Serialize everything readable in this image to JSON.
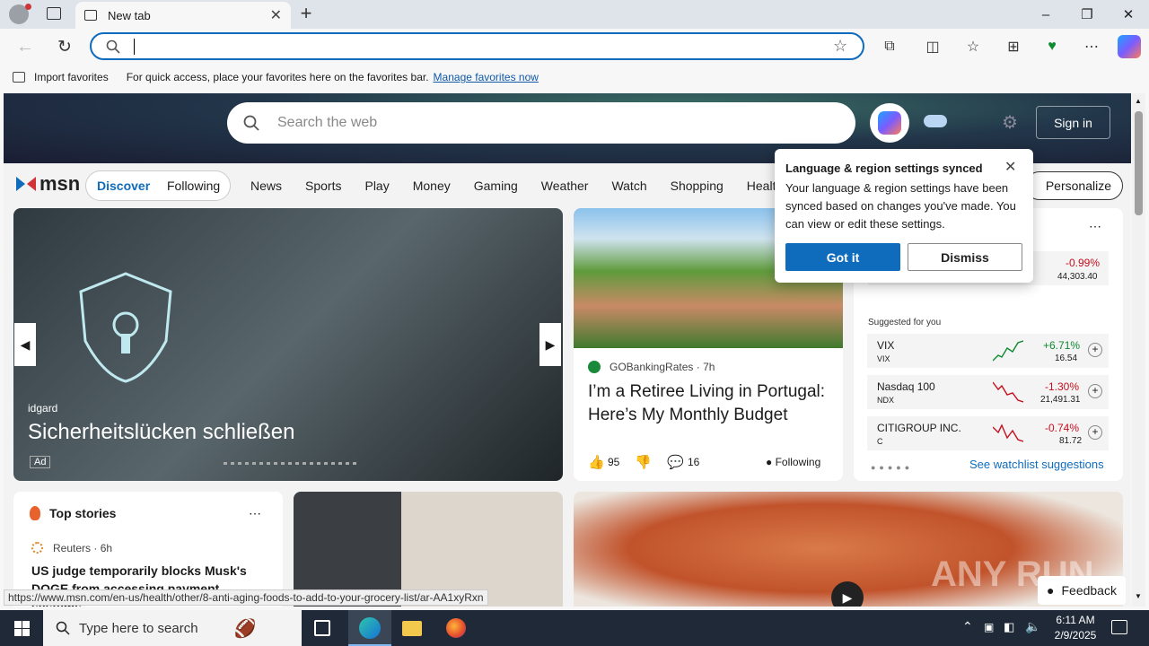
{
  "browser": {
    "tab_title": "New tab",
    "favbar": {
      "import": "Import favorites",
      "hint": "For quick access, place your favorites here on the favorites bar.",
      "manage": "Manage favorites now"
    }
  },
  "hero": {
    "search_placeholder": "Search the web",
    "sign_in": "Sign in"
  },
  "nav": {
    "logo": "msn",
    "discover": "Discover",
    "following": "Following",
    "tabs": [
      "News",
      "Sports",
      "Play",
      "Money",
      "Gaming",
      "Weather",
      "Watch",
      "Shopping",
      "Health"
    ],
    "personalize": "Personalize"
  },
  "carousel": {
    "source": "idgard",
    "title": "Sicherheitslücken schließen",
    "ad": "Ad"
  },
  "article": {
    "source": "GOBankingRates",
    "age": "7h",
    "title": "I’m a Retiree Living in Portugal: Here’s My Monthly Budget",
    "likes": "95",
    "comments": "16",
    "following": "Following"
  },
  "popup": {
    "title": "Language & region settings synced",
    "body": "Your language & region settings have been synced based on changes you've made. You can view or edit these settings.",
    "got_it": "Got it",
    "dismiss": "Dismiss"
  },
  "watchlist": {
    "top_change": "-0.99%",
    "top_value": "44,303.40",
    "suggested_label": "Suggested for you",
    "items": [
      {
        "name": "VIX",
        "sym": "VIX",
        "change": "+6.71%",
        "value": "16.54"
      },
      {
        "name": "Nasdaq 100",
        "sym": "NDX",
        "change": "-1.30%",
        "value": "21,491.31"
      },
      {
        "name": "CITIGROUP INC.",
        "sym": "C",
        "change": "-0.74%",
        "value": "81.72"
      }
    ],
    "see_more": "See watchlist suggestions"
  },
  "topstories": {
    "title": "Top stories",
    "source": "Reuters",
    "age": "6h",
    "headline": "US judge temporarily blocks Musk's DOGE from accessing payment systems"
  },
  "feedback": "Feedback",
  "status_url": "https://www.msn.com/en-us/health/other/8-anti-aging-foods-to-add-to-your-grocery-list/ar-AA1xyRxn",
  "taskbar": {
    "search": "Type here to search",
    "time": "6:11 AM",
    "date": "2/9/2025"
  },
  "watermark": "ANY RUN",
  "colors": {
    "accent": "#0f6cbd",
    "up": "#0e8a2f",
    "down": "#c50f1f"
  }
}
